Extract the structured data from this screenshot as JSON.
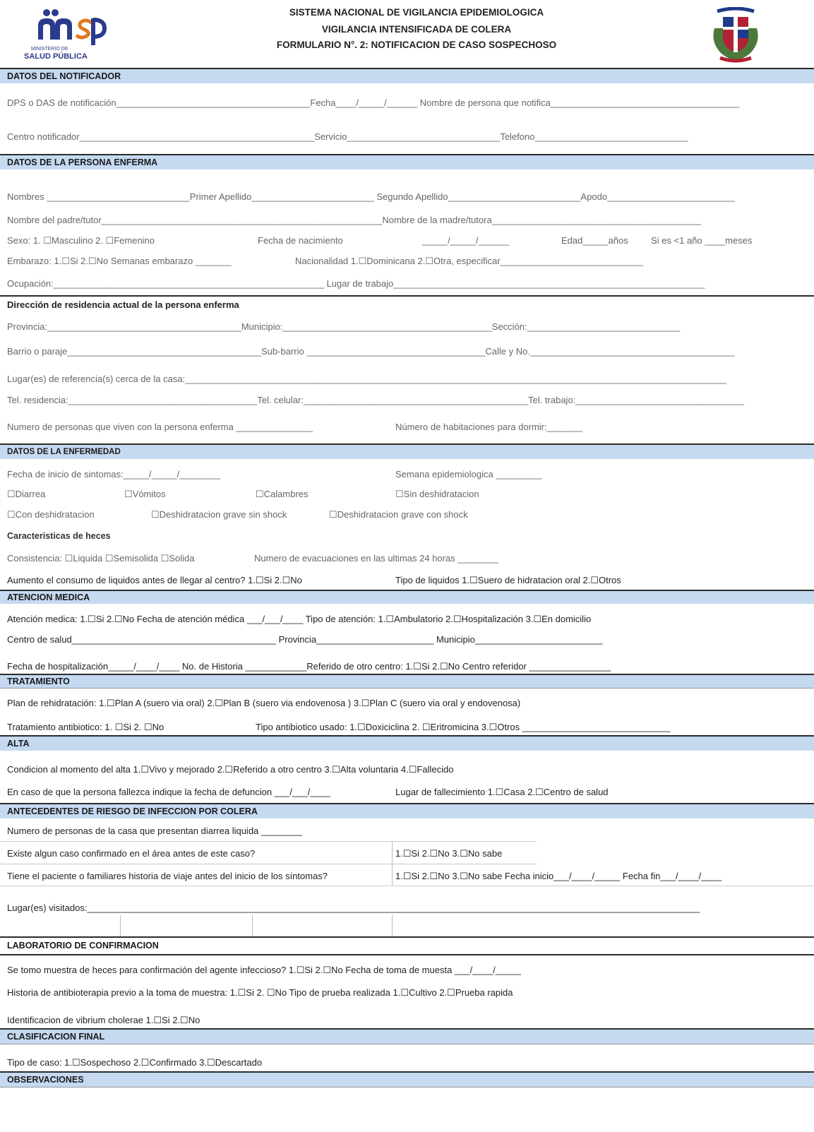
{
  "header": {
    "logo_text": "msp",
    "ministry": "MINISTERIO DE",
    "ministry2": "SALUD PÚBLICA",
    "title1": "SISTEMA NACIONAL DE VIGILANCIA EPIDEMIOLOGICA",
    "title2": "VIGILANCIA INTENSIFICADA DE COLERA",
    "title3": "FORMULARIO N°. 2:   NOTIFICACION DE CASO SOSPECHOSO"
  },
  "s1": {
    "title": "DATOS DEL NOTIFICADOR",
    "l1": "DPS o DAS de notificación______________________________________Fecha____/_____/______  Nombre de persona que notifica_____________________________________",
    "l2": "Centro notificador______________________________________________Servicio______________________________Telefono______________________________"
  },
  "s2": {
    "title": "DATOS DE LA PERSONA  ENFERMA",
    "l1": "Nombres ____________________________Primer Apellido________________________ Segundo Apellido__________________________Apodo_________________________",
    "l2": "Nombre del padre/tutor_______________________________________________________Nombre de la madre/tutora_________________________________________",
    "l3a": "Sexo:  1. ☐Masculino  2. ☐Femenino",
    "l3b": "Fecha de nacimiento",
    "l3c": "_____/_____/______",
    "l3d": "Edad_____años",
    "l3e": "Si es <1 año  ____meses",
    "l4a": "Embarazo:  1.☐Si  2.☐No   Semanas embarazo _______",
    "l4b": "Nacionalidad  1.☐Dominicana  2.☐Otra, especificar____________________________",
    "l5": "Ocupación:_____________________________________________________ Lugar de trabajo_____________________________________________________________",
    "addr_title": "Dirección de residencia actual de la persona enferma",
    "a1": "Provincia:______________________________________Municipio:_________________________________________Sección:______________________________",
    "a2": "Barrio o paraje______________________________________Sub-barrio ___________________________________Calle y No.________________________________________",
    "a3": "Lugar(es) de referencia(s) cerca de la casa:__________________________________________________________________________________________________________",
    "a4": "Tel. residencia:_____________________________________Tel. celular:____________________________________________Tel. trabajo:_________________________________",
    "a5a": "Numero de personas que viven con la persona enferma _______________",
    "a5b": "Número de habitaciones para dormir:_______"
  },
  "s3": {
    "title": "DATOS DE LA ENFERMEDAD",
    "l1a": "Fecha de inicio de sintomas:_____/_____/________",
    "l1b": "Semana epidemiologica _________",
    "c1": "☐Diarrea",
    "c2": "☐Vómitos",
    "c3": "☐Calambres",
    "c4": "☐Sin deshidratacion",
    "c5": "☐Con deshidratacion",
    "c6": "☐Deshidratacion grave sin shock",
    "c7": "☐Deshidratacion grave con shock",
    "heces_title": "Caracteristicas de heces",
    "h1a": "Consistencia:  ☐Liquida  ☐Semisolida  ☐Solida",
    "h1b": "Numero de evacuaciones en las ultimas 24 horas ________",
    "h2a": "Aumento el consumo de liquidos antes de llegar al centro?  1.☐Si   2.☐No",
    "h2b": "Tipo de liquidos  1.☐Suero de hidratacion oral    2.☐Otros"
  },
  "s4": {
    "title": "ATENCION MEDICA",
    "l1": "Atención medica:  1.☐Si   2.☐No   Fecha de atención médica ___/___/____   Tipo de atención:  1.☐Ambulatorio  2.☐Hospitalización   3.☐En domicilio",
    "l2": "Centro de salud________________________________________ Provincia_______________________   Municipio_________________________",
    "l3": "Fecha de hospitalización_____/____/____   No. de Historia ____________Referido de otro centro:  1.☐Si   2.☐No   Centro referidor ________________"
  },
  "s5": {
    "title": "TRATAMIENTO",
    "l1": "Plan de rehidratación:  1.☐Plan A  (suero via oral)   2.☐Plan B (suero via endovenosa )   3.☐Plan C (suero via oral y endovenosa)",
    "l2a": "Tratamiento antibiotico:   1. ☐Si   2. ☐No",
    "l2b": "Tipo antibiotico usado:  1.☐Doxiciclina   2. ☐Eritromicina  3.☐Otros _____________________________"
  },
  "s6": {
    "title": "ALTA",
    "l1": "Condicion al momento del alta  1.☐Vivo y mejorado   2.☐Referido a otro centro   3.☐Alta voluntaria  4.☐Fallecido",
    "l2a": "En caso de que la persona fallezca indique la fecha de defuncion ___/___/____",
    "l2b": "Lugar de fallecimiento 1.☐Casa  2.☐Centro de salud"
  },
  "s7": {
    "title": "ANTECEDENTES DE RIESGO DE INFECCION POR COLERA",
    "l1": "Numero de  personas de la casa que presentan diarrea liquida  ________",
    "l2a": "Existe algun caso confirmado en el área antes de este caso?",
    "l2b": "1.☐Si   2.☐No   3.☐No sabe",
    "l3a": "Tiene el paciente o familiares historia de viaje antes del inicio de los síntomas?",
    "l3b": "1.☐Si   2.☐No   3.☐No sabe   Fecha inicio___/____/_____   Fecha fin___/____/____",
    "l4": "Lugar(es) visitados:________________________________________________________________________________________________________________________"
  },
  "s8": {
    "title": "LABORATORIO DE CONFIRMACION",
    "l1": "Se tomo muestra de heces para confirmación del agente infeccioso?   1.☐Si      2.☐No   Fecha de toma de muesta ___/____/_____",
    "l2": "Historia de antibioterapia previo a la toma de muestra:  1.☐Si  2. ☐No    Tipo de prueba realizada    1.☐Cultivo    2.☐Prueba rapida",
    "l3": "Identificacion de vibrium cholerae    1.☐Si    2.☐No"
  },
  "s9": {
    "title": "CLASIFICACION FINAL",
    "l1": "Tipo de caso:  1.☐Sospechoso   2.☐Confirmado  3.☐Descartado"
  },
  "s10": {
    "title": "OBSERVACIONES"
  }
}
